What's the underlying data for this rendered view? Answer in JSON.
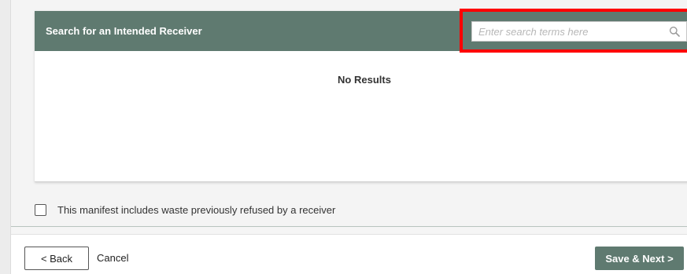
{
  "search_panel": {
    "title": "Search for an Intended Receiver",
    "search_placeholder": "Enter search terms here",
    "search_value": "",
    "empty_message": "No Results"
  },
  "options": {
    "refused_waste_label": "This manifest includes waste previously refused by a receiver",
    "refused_waste_checked": false
  },
  "footer": {
    "back_label": "< Back",
    "cancel_label": "Cancel",
    "save_next_label": "Save & Next >"
  },
  "colors": {
    "header_bg": "#5f7a70",
    "primary_button": "#5f7a70",
    "highlight": "#ff0000"
  },
  "icons": {
    "search": "search-icon"
  }
}
